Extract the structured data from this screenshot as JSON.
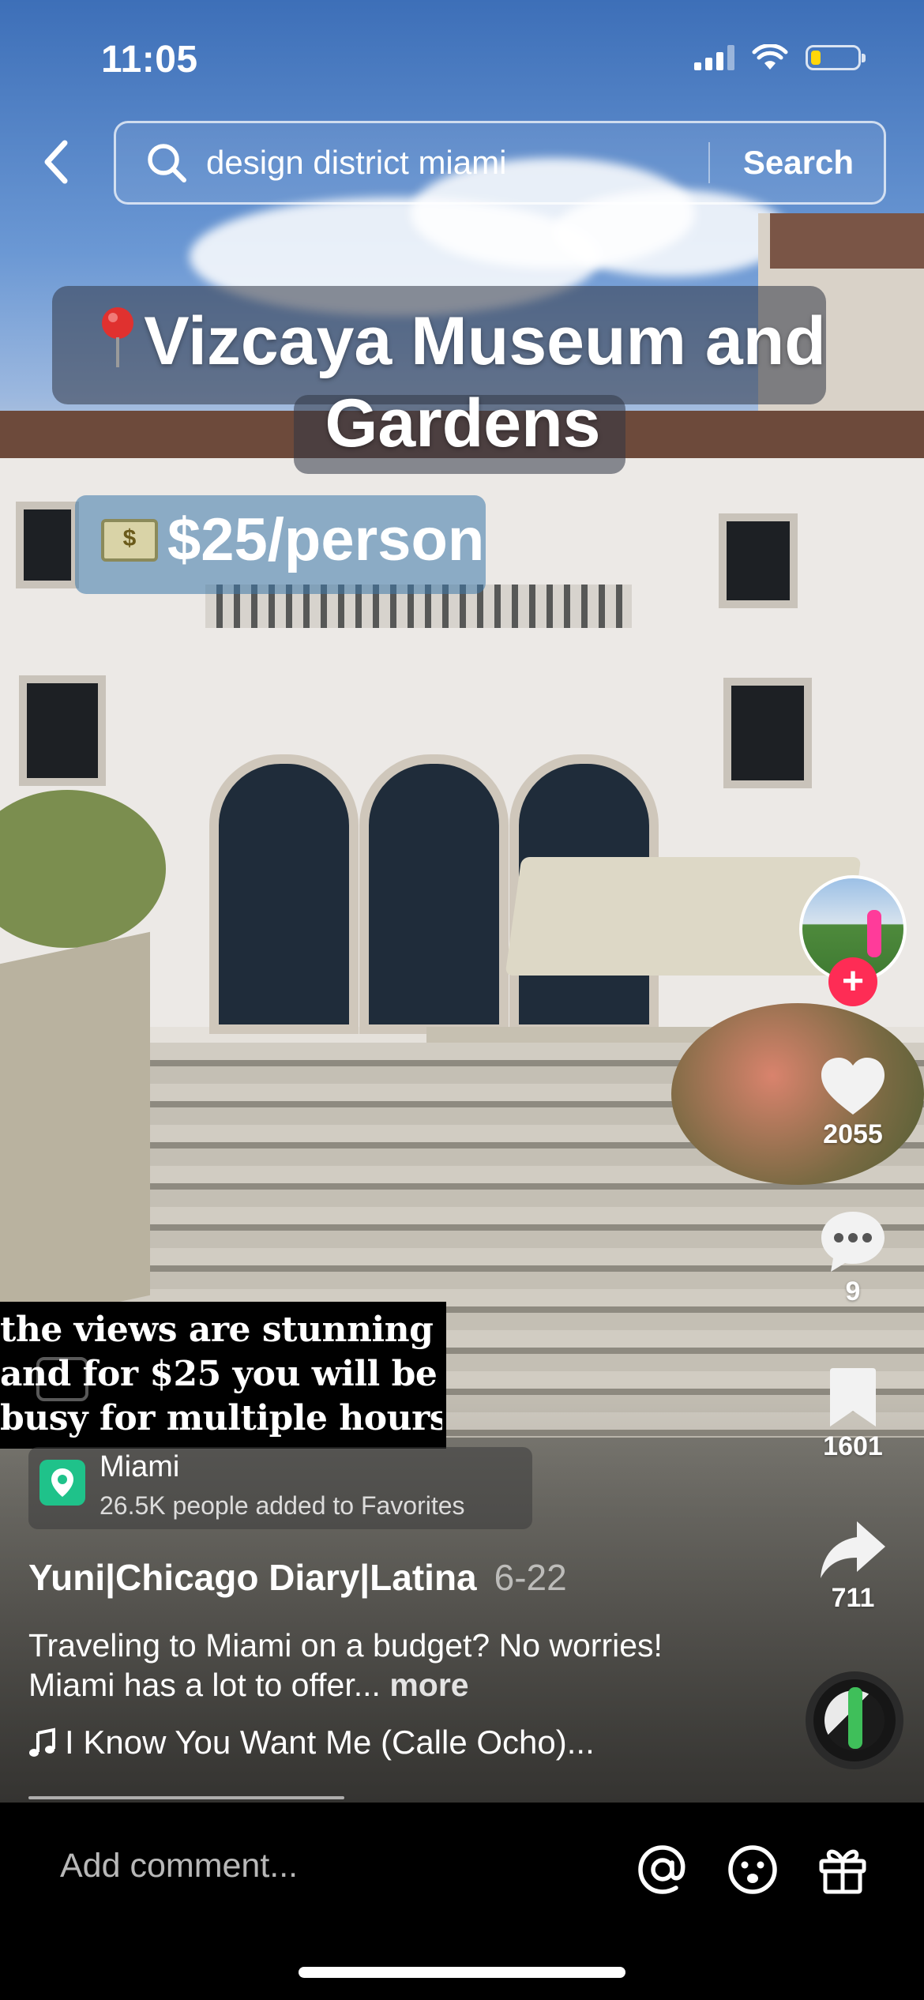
{
  "status_bar": {
    "time": "11:05",
    "battery_level": 0.2
  },
  "search": {
    "query": "design district miami",
    "button_label": "Search"
  },
  "overlay": {
    "title": "Vizcaya Museum and Gardens",
    "price": "$25/person",
    "quote_lines": "the views are stunning\nand for $25 you will be\nbusy for multiple hours"
  },
  "location": {
    "name": "Miami",
    "subtitle": "26.5K people added to Favorites"
  },
  "post": {
    "author": "Yuni|Chicago Diary|Latina",
    "date": "6-22",
    "caption": "Traveling to Miami on a budget? No worries! Miami has a lot to offer...",
    "more_label": "more",
    "music": "I Know You Want Me (Calle Ocho)..."
  },
  "actions": {
    "likes": "2055",
    "comments": "9",
    "saves": "1601",
    "shares": "711",
    "follow_symbol": "+"
  },
  "comment_bar": {
    "placeholder": "Add comment..."
  },
  "colors": {
    "accent": "#fe2c55",
    "location_pin": "#1fc28a",
    "battery": "#ffd60a"
  },
  "icons": [
    "back-icon",
    "search-icon",
    "pin-icon",
    "money-icon",
    "closed-caption-icon",
    "location-pin-icon",
    "heart-icon",
    "comment-icon",
    "bookmark-icon",
    "share-icon",
    "music-note-icon",
    "mention-icon",
    "emoji-icon",
    "gift-icon"
  ]
}
